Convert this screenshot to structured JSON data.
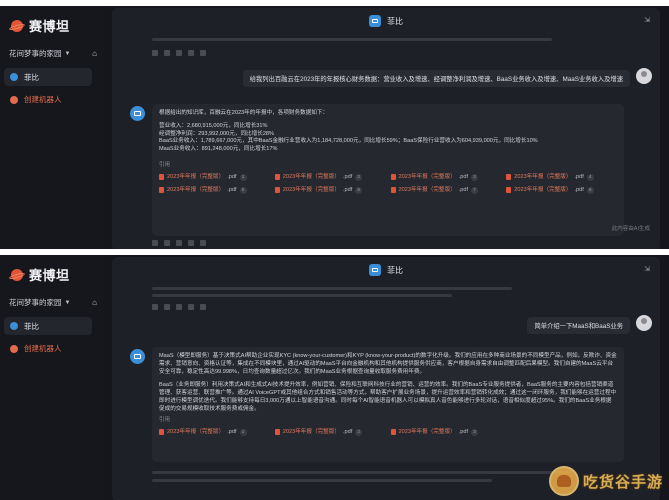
{
  "brand": {
    "name": "赛博坦"
  },
  "sidebar": {
    "space_name": "花间梦事的家园",
    "active_item": "菲比",
    "create_label": "创建机器人"
  },
  "chat": {
    "bot_name": "菲比"
  },
  "top": {
    "user_question": "给我列出百融云在2023年的年报核心财务数据：营业收入及增速、经调整净利润及增速、BaaS业务收入及增速、MaaS业务收入及增速",
    "answer_intro": "根据给出的知识库，百融云在2023年的年报中，各项财务数据如下：",
    "answer_lines": [
      "营业收入：2,680,915,000元，同比增长31%",
      "经调整净利润：293,992,000元，同比增长28%",
      "BaaS业务收入：1,789,667,000元，其中BaaS金融行业营收入为1,184,728,000元，同比增长59%；BaaS保险行业营收入为604,939,000元，同比增长10%",
      "MaaS业务收入：891,248,000元，同比增长17%"
    ],
    "cite_label": "引用",
    "files": [
      {
        "name": "2023年年报（完整版）",
        "ext": ".pdf",
        "num": "1"
      },
      {
        "name": "2023年年报（完整版）",
        "ext": ".pdf",
        "num": "2"
      },
      {
        "name": "2023年年报（完整版）",
        "ext": ".pdf",
        "num": "3"
      },
      {
        "name": "2023年年报（完整版）",
        "ext": ".pdf",
        "num": "4"
      },
      {
        "name": "2023年年报（完整版）",
        "ext": ".pdf",
        "num": "5"
      },
      {
        "name": "2023年年报（完整版）",
        "ext": ".pdf",
        "num": "6"
      },
      {
        "name": "2023年年报（完整版）",
        "ext": ".pdf",
        "num": "7"
      },
      {
        "name": "2023年年报（完整版）",
        "ext": ".pdf",
        "num": "8"
      }
    ],
    "ai_note": "此内容由AI生成"
  },
  "bottom": {
    "user_question": "简单介绍一下MaaS和BaaS业务",
    "paragraph_1": "MaaS（模型即服务）基于决策式AI帮助企业实现KYC (know-your-customer)和KYP (know-your-product)的数字化升级。我们的应用在多种商业场景的不同模型产品，例如，反欺诈、资金需求、营销意向、资格认证等，集成在不同模块里，通过AI驱动的MaaS平台向金融机构和其他机构提供服务供应商，客户根据自身需求自由调整匹配后果模型。我们自建的MaaS云平台安全可靠，稳定性高达99.998%，日均查询数量超过亿次。我们的MaaS业务根据查询量收取服务费用年费。",
    "paragraph_2": "BaaS（业务即服务）利用决策式AI和生成式AI技术提升效率，例如营销、保险和互联网科技行业的营销、运营的效率。我们的BaaS专业服务提供者，BaaS服务的主要内容包括营销渠道管理、获客运营、联营推广等。通过AI VoiceGPT或其他组合方式和销售活动等方式，帮助客户扩展业务场景，提升运营效率和营销转化成效；通过这一闭环服务，我们能够在运营过程中即时进行模型调优迭代。我们能够支持每日3,000万通以上智能语音沟通。同时每个AI智能语音机器人可以模拟真人音色能够进行多轮对话，语音相似度超过95%。我们的BaaS业务根据促成的交易规模收取技术服务费或佣金。",
    "cite_label": "引用",
    "files": [
      {
        "name": "2023年年报（完整版）",
        "ext": ".pdf",
        "num": "1"
      },
      {
        "name": "2023年年报（完整版）",
        "ext": ".pdf",
        "num": "2"
      },
      {
        "name": "2023年年报（完整版）",
        "ext": ".pdf",
        "num": "3"
      }
    ]
  },
  "watermark": {
    "text": "吃货谷手游"
  },
  "icons": [
    "brand-logo-icon",
    "chevron-down-icon",
    "home-icon",
    "bot-icon",
    "pin-icon",
    "pdf-icon",
    "avatar-icon"
  ],
  "colors": {
    "accent": "#3a8fd8",
    "brand": "#e2553a",
    "file": "#e07a5c",
    "background": "#15161b"
  }
}
